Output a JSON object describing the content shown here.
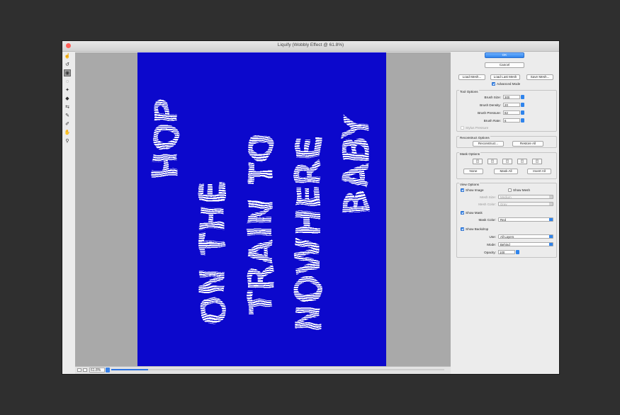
{
  "window": {
    "title": "Liquify (Wobbly Effect @ 61.8%)",
    "traffic_colors": [
      "#ff5f57",
      "#febc2e",
      "#28c840"
    ]
  },
  "toolbar": {
    "tools": [
      {
        "name": "forward-warp-tool",
        "glyph": "☝",
        "active": false
      },
      {
        "name": "reconstruct-tool",
        "glyph": "↺",
        "active": false
      },
      {
        "name": "smooth-tool",
        "glyph": "◉",
        "active": true
      },
      {
        "name": "twirl-clockwise-tool",
        "glyph": "◌",
        "active": false
      },
      {
        "name": "pucker-tool",
        "glyph": "✦",
        "active": false
      },
      {
        "name": "bloat-tool",
        "glyph": "◆",
        "active": false
      },
      {
        "name": "push-left-tool",
        "glyph": "⇆",
        "active": false
      },
      {
        "name": "freeze-mask-tool",
        "glyph": "✎",
        "active": false
      },
      {
        "name": "thaw-mask-tool",
        "glyph": "✐",
        "active": false
      },
      {
        "name": "hand-tool",
        "glyph": "✋",
        "active": false
      },
      {
        "name": "zoom-tool",
        "glyph": "⚲",
        "active": false
      }
    ]
  },
  "canvas": {
    "background": "#0c08cc",
    "text_color": "#ffffff",
    "columns": [
      "HOP",
      "ON THE",
      "TRAIN TO",
      "NOWHERE",
      "BABY"
    ]
  },
  "statusbar": {
    "zoom": "61.8%",
    "zoom_fraction": 0.11
  },
  "panel": {
    "ok_label": "OK",
    "cancel_label": "Cancel",
    "load_mesh_label": "Load Mesh...",
    "load_last_mesh_label": "Load Last Mesh",
    "save_mesh_label": "Save Mesh...",
    "advanced_mode_label": "Advanced Mode",
    "tool_options": {
      "title": "Tool Options",
      "rows": [
        {
          "label": "Brush Size:",
          "value": "300"
        },
        {
          "label": "Brush Density:",
          "value": "20"
        },
        {
          "label": "Brush Pressure:",
          "value": "82"
        },
        {
          "label": "Brush Rate:",
          "value": "6"
        }
      ],
      "stylus_label": "Stylus Pressure"
    },
    "reconstruct": {
      "title": "Reconstruct Options",
      "reconstruct_label": "Reconstruct...",
      "restore_label": "Restore All"
    },
    "mask": {
      "title": "Mask Options",
      "none_label": "None",
      "mask_all_label": "Mask All",
      "invert_all_label": "Invert All"
    },
    "view": {
      "title": "View Options",
      "show_image_label": "Show Image",
      "show_mesh_label": "Show Mesh",
      "mesh_size_label": "Mesh Size:",
      "mesh_size_value": "Medium",
      "mesh_color_label": "Mesh Color:",
      "mesh_color_value": "Gray",
      "show_mask_label": "Show Mask",
      "mask_color_label": "Mask Color:",
      "mask_color_value": "Red",
      "show_backdrop_label": "Show Backdrop",
      "use_label": "Use:",
      "use_value": "All Layers",
      "mode_label": "Mode:",
      "mode_value": "Behind",
      "opacity_label": "Opacity:",
      "opacity_value": "100"
    }
  }
}
